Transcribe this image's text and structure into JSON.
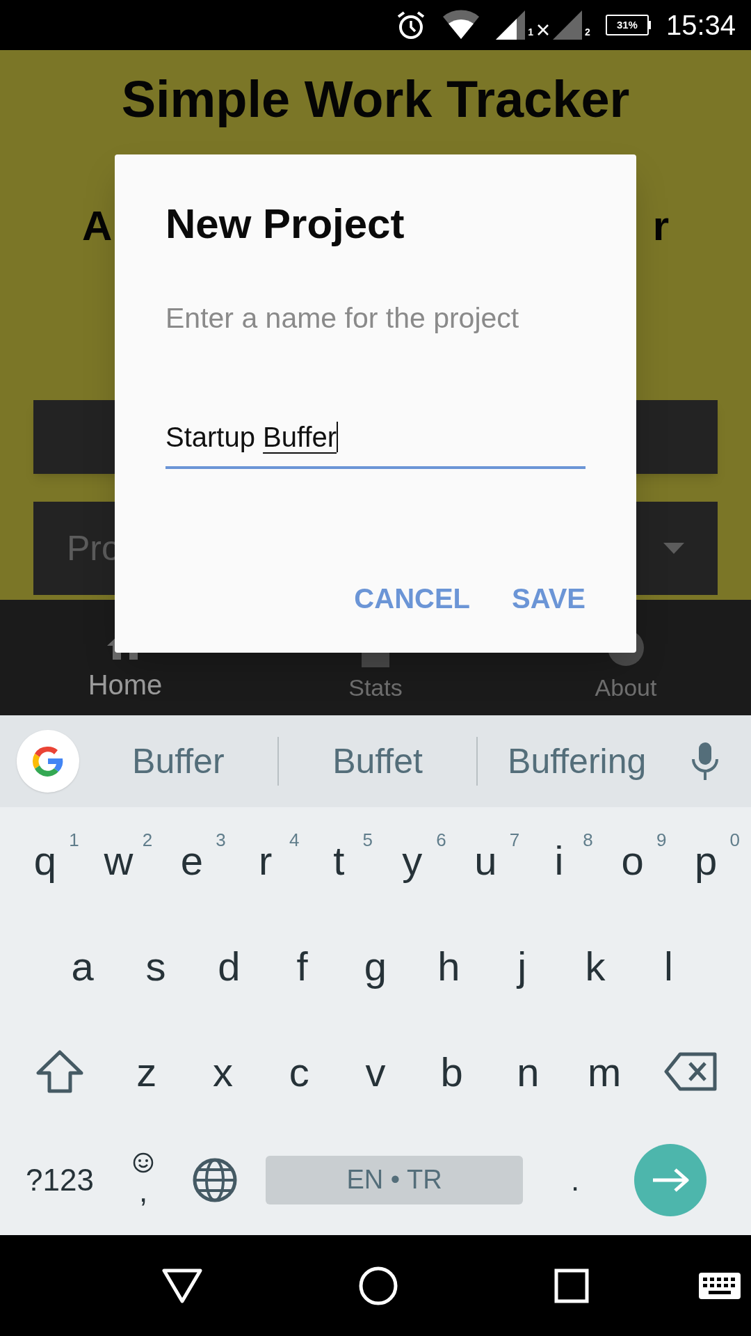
{
  "status_bar": {
    "sim_1": "1",
    "sim_2": "2",
    "battery": "31%",
    "time": "15:34"
  },
  "app": {
    "title": "Simple Work Tracker",
    "heading_left": "A",
    "heading_right": "r",
    "dropdown_text": "Pro"
  },
  "bottom_nav": [
    {
      "label": "Home",
      "selected": true,
      "kind": "home"
    },
    {
      "label": "Stats",
      "selected": false,
      "kind": "stats"
    },
    {
      "label": "About",
      "selected": false,
      "kind": "about"
    }
  ],
  "dialog": {
    "title": "New Project",
    "message": "Enter a name for the project",
    "field": {
      "value": "Startup ",
      "composing": "Buffer",
      "focused": true
    },
    "buttons": [
      "CANCEL",
      "SAVE"
    ]
  },
  "keyboard": {
    "suggestions": [
      "Buffer",
      "Buffet",
      "Buffering"
    ],
    "rows": [
      [
        {
          "label": "q",
          "hint": "1"
        },
        {
          "label": "w",
          "hint": "2"
        },
        {
          "label": "e",
          "hint": "3"
        },
        {
          "label": "r",
          "hint": "4"
        },
        {
          "label": "t",
          "hint": "5"
        },
        {
          "label": "y",
          "hint": "6"
        },
        {
          "label": "u",
          "hint": "7"
        },
        {
          "label": "i",
          "hint": "8"
        },
        {
          "label": "o",
          "hint": "9"
        },
        {
          "label": "p",
          "hint": "0"
        }
      ],
      [
        {
          "label": "a"
        },
        {
          "label": "s"
        },
        {
          "label": "d"
        },
        {
          "label": "f"
        },
        {
          "label": "g"
        },
        {
          "label": "h"
        },
        {
          "label": "j"
        },
        {
          "label": "k"
        },
        {
          "label": "l"
        }
      ],
      [
        {
          "kind": "shift"
        },
        {
          "label": "z"
        },
        {
          "label": "x"
        },
        {
          "label": "c"
        },
        {
          "label": "v"
        },
        {
          "label": "b"
        },
        {
          "label": "n"
        },
        {
          "label": "m"
        },
        {
          "kind": "backspace"
        }
      ]
    ],
    "symbols_key": "?123",
    "comma_key": ",",
    "space_label": "EN • TR",
    "period_key": "."
  }
}
